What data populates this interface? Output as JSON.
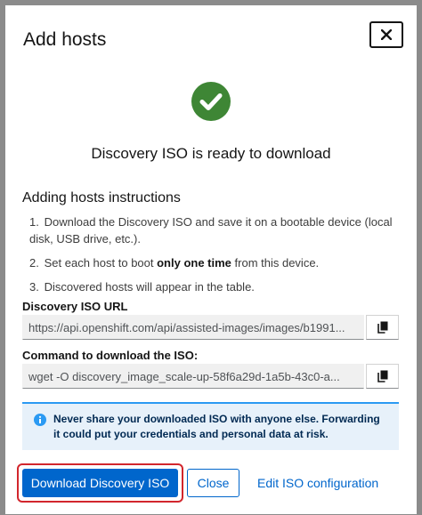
{
  "modal": {
    "title": "Add hosts",
    "close_icon": "close-icon",
    "status_icon": "check-circle-icon",
    "status_color": "#3e8635",
    "status_text": "Discovery ISO is ready to download",
    "instructions_title": "Adding hosts instructions",
    "steps": [
      {
        "num": "1.",
        "text": "Download the Discovery ISO and save it on a bootable device (local disk, USB drive, etc.)."
      },
      {
        "num": "2.",
        "pre": "Set each host to boot ",
        "bold": "only one time",
        "post": " from this device."
      },
      {
        "num": "3.",
        "text": "Discovered hosts will appear in the table."
      }
    ],
    "iso_url_label": "Discovery ISO URL",
    "iso_url_value": "https://api.openshift.com/api/assisted-images/images/b1991...",
    "command_label": "Command to download the ISO:",
    "command_value": "wget -O discovery_image_scale-up-58f6a29d-1a5b-43c0-a...",
    "copy_icon": "copy-icon",
    "alert_icon": "info-circle-icon",
    "alert_text": "Never share your downloaded ISO with anyone else. Forwarding it could put your credentials and personal data at risk.",
    "download_button": "Download Discovery ISO",
    "close_button": "Close",
    "edit_link": "Edit ISO configuration"
  },
  "colors": {
    "primary": "#0066cc",
    "success": "#3e8635",
    "highlight": "#d2262d",
    "alert_bg": "#e7f1fa",
    "alert_border": "#2b9af3"
  }
}
